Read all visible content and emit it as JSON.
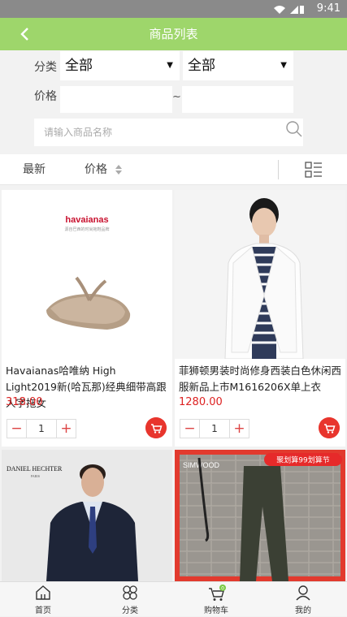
{
  "status": {
    "time": "9:41"
  },
  "header": {
    "title": "商品列表"
  },
  "filter": {
    "category_label": "分类",
    "category_value1": "全部",
    "category_value2": "全部",
    "price_label": "价格",
    "price_min": "",
    "price_max": "",
    "range_sep": "~",
    "search_placeholder": "请输入商品名称"
  },
  "sort": {
    "latest": "最新",
    "price": "价格"
  },
  "products": [
    {
      "name": "Havaianas哈唯纳 High Light2019新(哈瓦那)经典细带高跟人字拖女",
      "price": "318.00",
      "qty": "1",
      "brand": "havaianas",
      "brand_sub": "源自巴西的时尚拖鞋品牌"
    },
    {
      "name": "菲狮顿男装时尚修身西装白色休闲西服新品上市M1616206X单上衣",
      "price": "1280.00",
      "qty": "1"
    },
    {
      "name": "",
      "price": "",
      "qty": "",
      "brand": "DANIEL HECHTER",
      "brand_sub": "PARIS"
    },
    {
      "name": "",
      "price": "",
      "qty": "",
      "brand": "SIMWOOD",
      "promo": "聚划算99划算节"
    }
  ],
  "tabbar": [
    {
      "label": "首页",
      "icon": "home-icon"
    },
    {
      "label": "分类",
      "icon": "category-icon"
    },
    {
      "label": "购物车",
      "icon": "cart-icon",
      "badge": "0"
    },
    {
      "label": "我的",
      "icon": "user-icon"
    }
  ],
  "colors": {
    "header": "#9ed66b",
    "price": "#dd2222",
    "cart_button": "#e8352d"
  }
}
